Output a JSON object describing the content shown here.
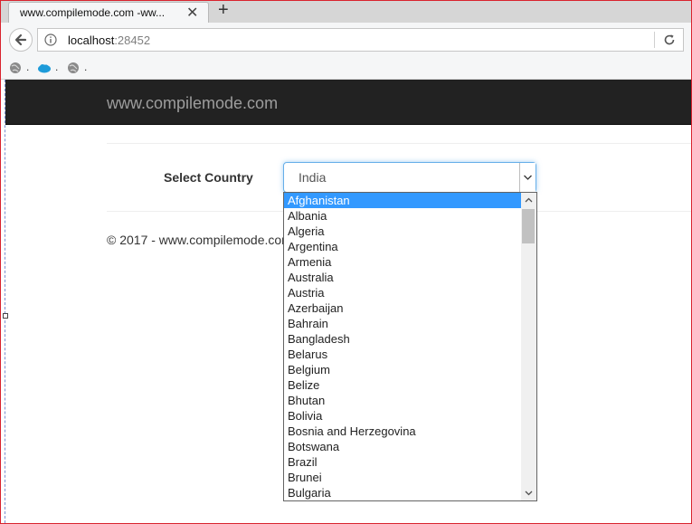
{
  "browser": {
    "tab_title": "www.compilemode.com -ww...",
    "url_host": "localhost",
    "url_port": ":28452",
    "bookmark_dot": "."
  },
  "site": {
    "brand": "www.compilemode.com",
    "field_label": "Select Country",
    "selected_value": "India",
    "footer": "© 2017 - www.compilemode.com",
    "countries": [
      "Afghanistan",
      "Albania",
      "Algeria",
      "Argentina",
      "Armenia",
      "Australia",
      "Austria",
      "Azerbaijan",
      "Bahrain",
      "Bangladesh",
      "Belarus",
      "Belgium",
      "Belize",
      "Bhutan",
      "Bolivia",
      "Bosnia and Herzegovina",
      "Botswana",
      "Brazil",
      "Brunei",
      "Bulgaria"
    ],
    "highlighted_index": 0
  },
  "colors": {
    "header_bg": "#222222",
    "brand_text": "#9d9d9d",
    "highlight": "#3399ff",
    "focus_border": "#66afe9"
  },
  "icons": {
    "back": "back-arrow-icon",
    "info": "info-icon",
    "reload": "reload-icon",
    "close_tab": "close-icon",
    "new_tab": "plus-icon",
    "select_arrow": "chevron-down-icon"
  }
}
